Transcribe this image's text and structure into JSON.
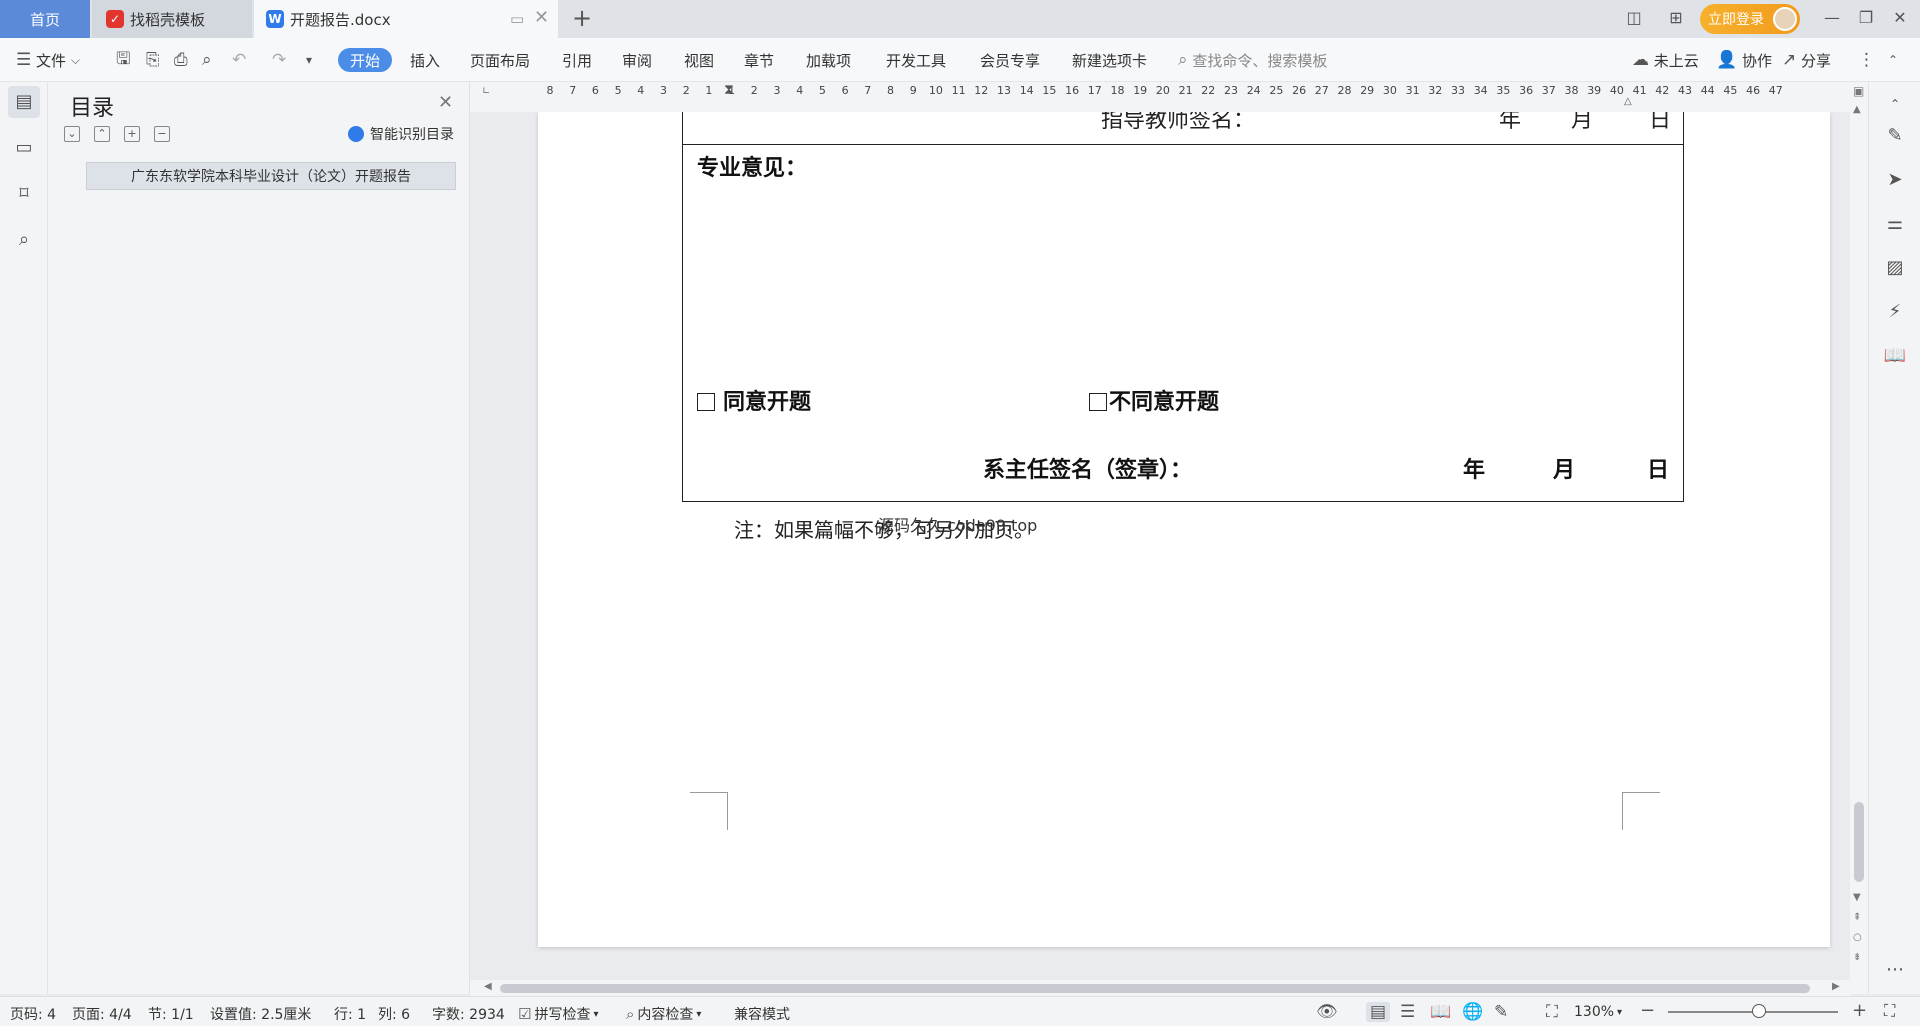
{
  "tabs": {
    "home": "首页",
    "find_template": "找稻壳模板",
    "document": "开题报告.docx",
    "new_tab": "+"
  },
  "titlebar": {
    "login": "立即登录"
  },
  "ribbon": {
    "file_menu": "文件",
    "tabs": [
      "开始",
      "插入",
      "页面布局",
      "引用",
      "审阅",
      "视图",
      "章节",
      "加载项",
      "开发工具",
      "会员专享",
      "新建选项卡"
    ],
    "search_placeholder": "查找命令、搜索模板",
    "cloud": "未上云",
    "collaborate": "协作",
    "share": "分享"
  },
  "toc": {
    "title": "目录",
    "smart_recognize": "智能识别目录",
    "items": [
      "广东东软学院本科毕业设计（论文）开题报告"
    ]
  },
  "ruler": {
    "labels": [
      "8",
      "7",
      "6",
      "5",
      "4",
      "3",
      "2",
      "1",
      "1",
      "2",
      "3",
      "4",
      "5",
      "6",
      "7",
      "8",
      "9",
      "10",
      "11",
      "12",
      "13",
      "14",
      "15",
      "16",
      "17",
      "18",
      "19",
      "20",
      "21",
      "22",
      "23",
      "24",
      "25",
      "26",
      "27",
      "28",
      "29",
      "30",
      "31",
      "32",
      "33",
      "34",
      "35",
      "36",
      "37",
      "38",
      "39",
      "40",
      "41",
      "42",
      "43",
      "44",
      "45",
      "46",
      "47"
    ]
  },
  "document": {
    "cut_top_sig": "指导教师签名：",
    "cut_top_date": [
      "年",
      "月",
      "日"
    ],
    "major_opinion": "专业意见：",
    "agree": "同意开题",
    "disagree": "不同意开题",
    "dept_sign": "系主任签名（签章）：",
    "date_labels": [
      "年",
      "月",
      "日"
    ],
    "note": "注：如果篇幅不够，可另外加页。",
    "watermark": "源码久久 code99.top"
  },
  "statusbar": {
    "page_code": "页码: 4",
    "pages": "页面: 4/4",
    "section": "节: 1/1",
    "setting": "设置值: 2.5厘米",
    "line": "行: 1",
    "column": "列: 6",
    "word_count": "字数: 2934",
    "spell_check": "拼写检查",
    "content_check": "内容检查",
    "compat_mode": "兼容模式",
    "zoom": "130%",
    "zoom_level_percent": 130
  }
}
